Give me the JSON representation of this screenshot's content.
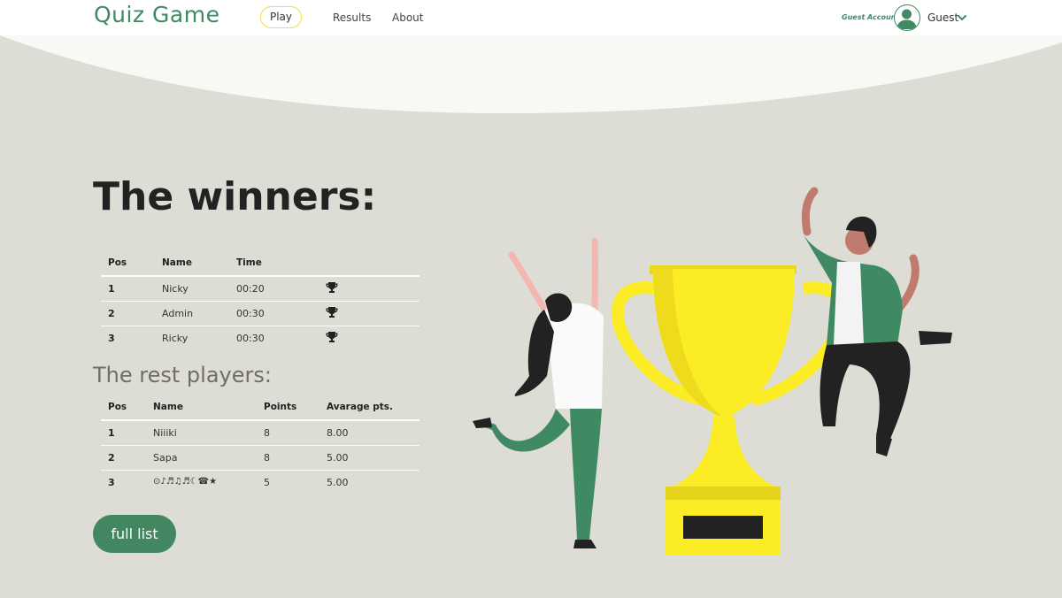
{
  "app": {
    "logo": "Quiz Game",
    "brand_color": "#3f8a63",
    "accent_color": "#f2dc4a"
  },
  "nav": {
    "play": "Play",
    "results": "Results",
    "about": "About"
  },
  "account": {
    "label": "Guest Account",
    "name": "Guest",
    "avatar_icon": "user-avatar-icon",
    "dropdown_icon": "chevron-down-icon"
  },
  "winners": {
    "title": "The winners:",
    "columns": [
      "Pos",
      "Name",
      "Time"
    ],
    "rows": [
      {
        "pos": "1",
        "name": "Nicky",
        "time": "00:20",
        "icon": "trophy-icon"
      },
      {
        "pos": "2",
        "name": "Admin",
        "time": "00:30",
        "icon": "trophy-icon"
      },
      {
        "pos": "3",
        "name": "Ricky",
        "time": "00:30",
        "icon": "trophy-icon"
      }
    ]
  },
  "rest": {
    "title": "The rest players:",
    "columns": [
      "Pos",
      "Name",
      "Points",
      "Avarage pts."
    ],
    "rows": [
      {
        "pos": "1",
        "name": "Niiiki",
        "points": "8",
        "avg": "8.00"
      },
      {
        "pos": "2",
        "name": "Sapa",
        "points": "8",
        "avg": "5.00"
      },
      {
        "pos": "3",
        "name": "⊙♪♬♫♬☾☎★",
        "points": "5",
        "avg": "5.00"
      }
    ]
  },
  "actions": {
    "full_list": "full list"
  },
  "illustration": {
    "subject": "celebrating-players-with-trophy",
    "trophy_color": "#fbec25"
  }
}
